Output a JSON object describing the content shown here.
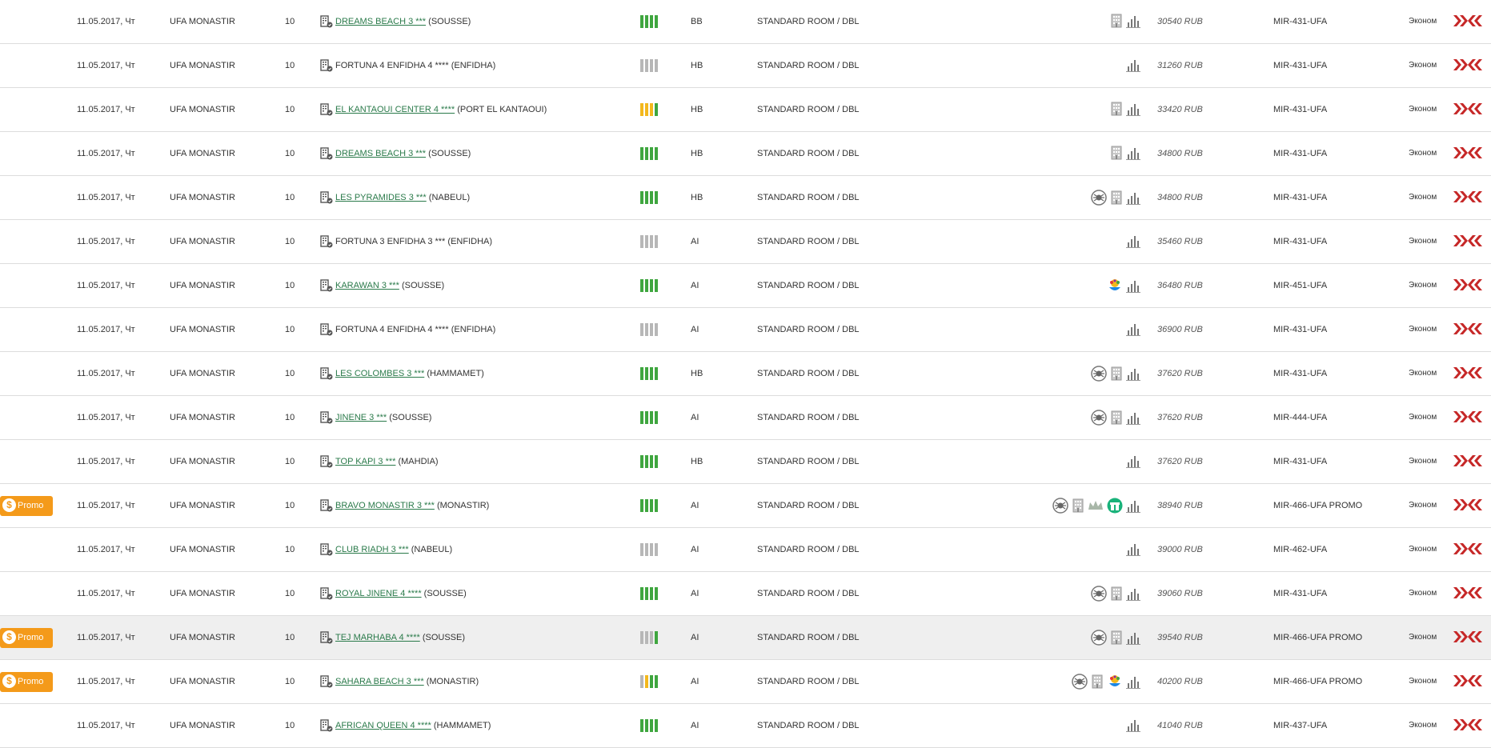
{
  "rows": [
    {
      "promo": false,
      "date": "11.05.2017, Чт",
      "route": "UFA MONASTIR",
      "nights": "10",
      "hotel": {
        "name": "DREAMS BEACH 3 ***",
        "location": "(SOUSSE)",
        "link": true
      },
      "availability": [
        "g",
        "g",
        "g",
        "g"
      ],
      "meal": "BB",
      "room": "STANDARD ROOM / DBL",
      "icons": [
        "building-icon",
        "chart-icon"
      ],
      "price": "30540 RUB",
      "flight": "MIR-431-UFA",
      "service_class": "Эконом"
    },
    {
      "promo": false,
      "date": "11.05.2017, Чт",
      "route": "UFA MONASTIR",
      "nights": "10",
      "hotel": {
        "name": "FORTUNA 4 ENFIDHA 4 ****",
        "location": "(ENFIDHA)",
        "link": false
      },
      "availability": [
        "x",
        "x",
        "x",
        "x"
      ],
      "meal": "HB",
      "room": "STANDARD ROOM / DBL",
      "icons": [
        "chart-icon"
      ],
      "price": "31260 RUB",
      "flight": "MIR-431-UFA",
      "service_class": "Эконом"
    },
    {
      "promo": false,
      "date": "11.05.2017, Чт",
      "route": "UFA MONASTIR",
      "nights": "10",
      "hotel": {
        "name": "EL KANTAOUI CENTER 4 ****",
        "location": "(PORT EL KANTAOUI)",
        "link": true
      },
      "availability": [
        "y",
        "y",
        "y",
        "g"
      ],
      "meal": "HB",
      "room": "STANDARD ROOM / DBL",
      "icons": [
        "building-icon",
        "chart-icon"
      ],
      "price": "33420 RUB",
      "flight": "MIR-431-UFA",
      "service_class": "Эконом"
    },
    {
      "promo": false,
      "date": "11.05.2017, Чт",
      "route": "UFA MONASTIR",
      "nights": "10",
      "hotel": {
        "name": "DREAMS BEACH 3 ***",
        "location": "(SOUSSE)",
        "link": true
      },
      "availability": [
        "g",
        "g",
        "g",
        "g"
      ],
      "meal": "HB",
      "room": "STANDARD ROOM / DBL",
      "icons": [
        "building-icon",
        "chart-icon"
      ],
      "price": "34800 RUB",
      "flight": "MIR-431-UFA",
      "service_class": "Эконом"
    },
    {
      "promo": false,
      "date": "11.05.2017, Чт",
      "route": "UFA MONASTIR",
      "nights": "10",
      "hotel": {
        "name": "LES PYRAMIDES 3 ***",
        "location": "(NABEUL)",
        "link": true
      },
      "availability": [
        "g",
        "g",
        "g",
        "g"
      ],
      "meal": "HB",
      "room": "STANDARD ROOM / DBL",
      "icons": [
        "spider-icon",
        "building-icon",
        "chart-icon"
      ],
      "price": "34800 RUB",
      "flight": "MIR-431-UFA",
      "service_class": "Эконом"
    },
    {
      "promo": false,
      "date": "11.05.2017, Чт",
      "route": "UFA MONASTIR",
      "nights": "10",
      "hotel": {
        "name": "FORTUNA 3 ENFIDHA 3 ***",
        "location": "(ENFIDHA)",
        "link": false
      },
      "availability": [
        "x",
        "x",
        "x",
        "x"
      ],
      "meal": "AI",
      "room": "STANDARD ROOM / DBL",
      "icons": [
        "chart-icon"
      ],
      "price": "35460 RUB",
      "flight": "MIR-431-UFA",
      "service_class": "Эконом"
    },
    {
      "promo": false,
      "date": "11.05.2017, Чт",
      "route": "UFA MONASTIR",
      "nights": "10",
      "hotel": {
        "name": "KARAWAN 3 ***",
        "location": "(SOUSSE)",
        "link": true
      },
      "availability": [
        "g",
        "g",
        "g",
        "g"
      ],
      "meal": "AI",
      "room": "STANDARD ROOM / DBL",
      "icons": [
        "kids-icon",
        "chart-icon"
      ],
      "price": "36480 RUB",
      "flight": "MIR-451-UFA",
      "service_class": "Эконом"
    },
    {
      "promo": false,
      "date": "11.05.2017, Чт",
      "route": "UFA MONASTIR",
      "nights": "10",
      "hotel": {
        "name": "FORTUNA 4 ENFIDHA 4 ****",
        "location": "(ENFIDHA)",
        "link": false
      },
      "availability": [
        "x",
        "x",
        "x",
        "x"
      ],
      "meal": "AI",
      "room": "STANDARD ROOM / DBL",
      "icons": [
        "chart-icon"
      ],
      "price": "36900 RUB",
      "flight": "MIR-431-UFA",
      "service_class": "Эконом"
    },
    {
      "promo": false,
      "date": "11.05.2017, Чт",
      "route": "UFA MONASTIR",
      "nights": "10",
      "hotel": {
        "name": "LES COLOMBES 3 ***",
        "location": "(HAMMAMET)",
        "link": true
      },
      "availability": [
        "g",
        "g",
        "g",
        "g"
      ],
      "meal": "HB",
      "room": "STANDARD ROOM / DBL",
      "icons": [
        "spider-icon",
        "building-icon",
        "chart-icon"
      ],
      "price": "37620 RUB",
      "flight": "MIR-431-UFA",
      "service_class": "Эконом"
    },
    {
      "promo": false,
      "date": "11.05.2017, Чт",
      "route": "UFA MONASTIR",
      "nights": "10",
      "hotel": {
        "name": "JINENE 3 ***",
        "location": "(SOUSSE)",
        "link": true
      },
      "availability": [
        "g",
        "g",
        "g",
        "g"
      ],
      "meal": "AI",
      "room": "STANDARD ROOM / DBL",
      "icons": [
        "spider-icon",
        "building-icon",
        "chart-icon"
      ],
      "price": "37620 RUB",
      "flight": "MIR-444-UFA",
      "service_class": "Эконом"
    },
    {
      "promo": false,
      "date": "11.05.2017, Чт",
      "route": "UFA MONASTIR",
      "nights": "10",
      "hotel": {
        "name": "TOP KAPI 3 ***",
        "location": "(MAHDIA)",
        "link": true
      },
      "availability": [
        "g",
        "g",
        "g",
        "g"
      ],
      "meal": "HB",
      "room": "STANDARD ROOM / DBL",
      "icons": [
        "chart-icon"
      ],
      "price": "37620 RUB",
      "flight": "MIR-431-UFA",
      "service_class": "Эконом"
    },
    {
      "promo": true,
      "date": "11.05.2017, Чт",
      "route": "UFA MONASTIR",
      "nights": "10",
      "hotel": {
        "name": "BRAVO MONASTIR 3 ***",
        "location": "(MONASTIR)",
        "link": true
      },
      "availability": [
        "g",
        "g",
        "g",
        "g"
      ],
      "meal": "AI",
      "room": "STANDARD ROOM / DBL",
      "icons": [
        "spider-icon",
        "building-icon",
        "crown-icon",
        "gift-icon",
        "chart-icon"
      ],
      "price": "38940 RUB",
      "flight": "MIR-466-UFA PROMO",
      "service_class": "Эконом"
    },
    {
      "promo": false,
      "date": "11.05.2017, Чт",
      "route": "UFA MONASTIR",
      "nights": "10",
      "hotel": {
        "name": "CLUB RIADH 3 ***",
        "location": "(NABEUL)",
        "link": true
      },
      "availability": [
        "x",
        "x",
        "x",
        "x"
      ],
      "meal": "AI",
      "room": "STANDARD ROOM / DBL",
      "icons": [
        "chart-icon"
      ],
      "price": "39000 RUB",
      "flight": "MIR-462-UFA",
      "service_class": "Эконом"
    },
    {
      "promo": false,
      "date": "11.05.2017, Чт",
      "route": "UFA MONASTIR",
      "nights": "10",
      "hotel": {
        "name": "ROYAL JINENE 4 ****",
        "location": "(SOUSSE)",
        "link": true
      },
      "availability": [
        "g",
        "g",
        "g",
        "g"
      ],
      "meal": "AI",
      "room": "STANDARD ROOM / DBL",
      "icons": [
        "spider-icon",
        "building-icon",
        "chart-icon"
      ],
      "price": "39060 RUB",
      "flight": "MIR-431-UFA",
      "service_class": "Эконом"
    },
    {
      "promo": true,
      "highlight": true,
      "date": "11.05.2017, Чт",
      "route": "UFA MONASTIR",
      "nights": "10",
      "hotel": {
        "name": "TEJ MARHABA 4 ****",
        "location": "(SOUSSE)",
        "link": true
      },
      "availability": [
        "x",
        "x",
        "x",
        "g"
      ],
      "meal": "AI",
      "room": "STANDARD ROOM / DBL",
      "icons": [
        "spider-icon",
        "building-icon",
        "chart-icon"
      ],
      "price": "39540 RUB",
      "flight": "MIR-466-UFA PROMO",
      "service_class": "Эконом"
    },
    {
      "promo": true,
      "date": "11.05.2017, Чт",
      "route": "UFA MONASTIR",
      "nights": "10",
      "hotel": {
        "name": "SAHARA BEACH 3 ***",
        "location": "(MONASTIR)",
        "link": true
      },
      "availability": [
        "x",
        "y",
        "g",
        "g"
      ],
      "meal": "AI",
      "room": "STANDARD ROOM / DBL",
      "icons": [
        "spider-icon",
        "building-icon",
        "kids-icon",
        "chart-icon"
      ],
      "price": "40200 RUB",
      "flight": "MIR-466-UFA PROMO",
      "service_class": "Эконом"
    },
    {
      "promo": false,
      "date": "11.05.2017, Чт",
      "route": "UFA MONASTIR",
      "nights": "10",
      "hotel": {
        "name": "AFRICAN QUEEN 4 ****",
        "location": "(HAMMAMET)",
        "link": true
      },
      "availability": [
        "g",
        "g",
        "g",
        "g"
      ],
      "meal": "AI",
      "room": "STANDARD ROOM / DBL",
      "icons": [
        "chart-icon"
      ],
      "price": "41040 RUB",
      "flight": "MIR-437-UFA",
      "service_class": "Эконом"
    }
  ],
  "promo_label": "Promo",
  "colors": {
    "accent_green": "#2a7a4a",
    "promo_orange": "#f49a1a",
    "action_red": "#c62828",
    "avail_green": "#3fa63f",
    "avail_yellow": "#f3b81d",
    "avail_grey": "#b7b7b7"
  }
}
